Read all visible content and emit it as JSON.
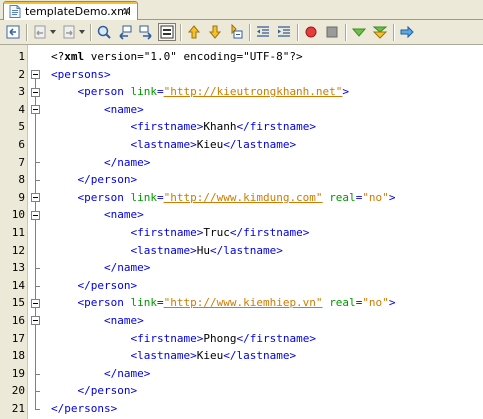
{
  "tab": {
    "title": "templateDemo.xml",
    "close_glyph": "x"
  },
  "toolbar": {
    "buttons": [
      {
        "name": "back-to-source-icon",
        "label": ""
      },
      {
        "name": "go-back-icon",
        "label": ""
      },
      {
        "name": "go-forward-icon",
        "label": ""
      },
      {
        "name": "find-selection-icon",
        "label": ""
      },
      {
        "name": "find-previous-icon",
        "label": ""
      },
      {
        "name": "find-next-icon",
        "label": ""
      },
      {
        "name": "toggle-highlight-search-icon",
        "label": ""
      },
      {
        "name": "previous-bookmark-icon",
        "label": ""
      },
      {
        "name": "next-bookmark-icon",
        "label": ""
      },
      {
        "name": "toggle-bookmark-icon",
        "label": ""
      },
      {
        "name": "shift-left-icon",
        "label": ""
      },
      {
        "name": "shift-right-icon",
        "label": ""
      },
      {
        "name": "start-macro-icon",
        "label": ""
      },
      {
        "name": "stop-macro-icon",
        "label": ""
      },
      {
        "name": "check-xml-icon",
        "label": ""
      },
      {
        "name": "validate-xml-icon",
        "label": ""
      },
      {
        "name": "xsl-transform-icon",
        "label": ""
      }
    ]
  },
  "editor": {
    "line_numbers": [
      "1",
      "2",
      "3",
      "4",
      "5",
      "6",
      "7",
      "8",
      "9",
      "10",
      "11",
      "12",
      "13",
      "14",
      "15",
      "16",
      "17",
      "18",
      "19",
      "20",
      "21"
    ],
    "lines": [
      {
        "indent": "",
        "parts": [
          {
            "t": "pi",
            "v": "<?"
          },
          {
            "t": "pib",
            "v": "xml"
          },
          {
            "t": "pi",
            "v": " version=\"1.0\" encoding=\"UTF-8\"?>"
          }
        ]
      },
      {
        "indent": "",
        "parts": [
          {
            "t": "tag",
            "v": "<persons>"
          }
        ]
      },
      {
        "indent": "    ",
        "parts": [
          {
            "t": "tag",
            "v": "<person "
          },
          {
            "t": "attr",
            "v": "link"
          },
          {
            "t": "tag",
            "v": "="
          },
          {
            "t": "val",
            "v": "\"http://kieutrongkhanh.net\""
          },
          {
            "t": "tag",
            "v": ">"
          }
        ]
      },
      {
        "indent": "        ",
        "parts": [
          {
            "t": "tag",
            "v": "<name>"
          }
        ]
      },
      {
        "indent": "            ",
        "parts": [
          {
            "t": "tag",
            "v": "<firstname>"
          },
          {
            "t": "text",
            "v": "Khanh"
          },
          {
            "t": "tag",
            "v": "</firstname>"
          }
        ]
      },
      {
        "indent": "            ",
        "parts": [
          {
            "t": "tag",
            "v": "<lastname>"
          },
          {
            "t": "text",
            "v": "Kieu"
          },
          {
            "t": "tag",
            "v": "</lastname>"
          }
        ]
      },
      {
        "indent": "        ",
        "parts": [
          {
            "t": "tag",
            "v": "</name>"
          }
        ]
      },
      {
        "indent": "    ",
        "parts": [
          {
            "t": "tag",
            "v": "</person>"
          }
        ]
      },
      {
        "indent": "    ",
        "parts": [
          {
            "t": "tag",
            "v": "<person "
          },
          {
            "t": "attr",
            "v": "link"
          },
          {
            "t": "tag",
            "v": "="
          },
          {
            "t": "val",
            "v": "\"http://www.kimdung.com\""
          },
          {
            "t": "tag",
            "v": " "
          },
          {
            "t": "attr",
            "v": "real"
          },
          {
            "t": "tag",
            "v": "="
          },
          {
            "t": "valplain",
            "v": "\"no\""
          },
          {
            "t": "tag",
            "v": ">"
          }
        ]
      },
      {
        "indent": "        ",
        "parts": [
          {
            "t": "tag",
            "v": "<name>"
          }
        ]
      },
      {
        "indent": "            ",
        "parts": [
          {
            "t": "tag",
            "v": "<firstname>"
          },
          {
            "t": "text",
            "v": "Truc"
          },
          {
            "t": "tag",
            "v": "</firstname>"
          }
        ]
      },
      {
        "indent": "            ",
        "parts": [
          {
            "t": "tag",
            "v": "<lastname>"
          },
          {
            "t": "text",
            "v": "Hu"
          },
          {
            "t": "tag",
            "v": "</lastname>"
          }
        ]
      },
      {
        "indent": "        ",
        "parts": [
          {
            "t": "tag",
            "v": "</name>"
          }
        ]
      },
      {
        "indent": "    ",
        "parts": [
          {
            "t": "tag",
            "v": "</person>"
          }
        ]
      },
      {
        "indent": "    ",
        "parts": [
          {
            "t": "tag",
            "v": "<person "
          },
          {
            "t": "attr",
            "v": "link"
          },
          {
            "t": "tag",
            "v": "="
          },
          {
            "t": "val",
            "v": "\"http://www.kiemhiep.vn\""
          },
          {
            "t": "tag",
            "v": " "
          },
          {
            "t": "attr",
            "v": "real"
          },
          {
            "t": "tag",
            "v": "="
          },
          {
            "t": "valplain",
            "v": "\"no\""
          },
          {
            "t": "tag",
            "v": ">"
          }
        ]
      },
      {
        "indent": "        ",
        "parts": [
          {
            "t": "tag",
            "v": "<name>"
          }
        ]
      },
      {
        "indent": "            ",
        "parts": [
          {
            "t": "tag",
            "v": "<firstname>"
          },
          {
            "t": "text",
            "v": "Phong"
          },
          {
            "t": "tag",
            "v": "</firstname>"
          }
        ]
      },
      {
        "indent": "            ",
        "parts": [
          {
            "t": "tag",
            "v": "<lastname>"
          },
          {
            "t": "text",
            "v": "Kieu"
          },
          {
            "t": "tag",
            "v": "</lastname>"
          }
        ]
      },
      {
        "indent": "        ",
        "parts": [
          {
            "t": "tag",
            "v": "</name>"
          }
        ]
      },
      {
        "indent": "    ",
        "parts": [
          {
            "t": "tag",
            "v": "</person>"
          }
        ]
      },
      {
        "indent": "",
        "parts": [
          {
            "t": "tag",
            "v": "</persons>"
          }
        ]
      }
    ]
  },
  "colors": {
    "tag": "#0000e6",
    "attribute": "#009900",
    "attribute_value": "#ce7b00",
    "text": "#000000",
    "chrome": "#ece9d8"
  }
}
